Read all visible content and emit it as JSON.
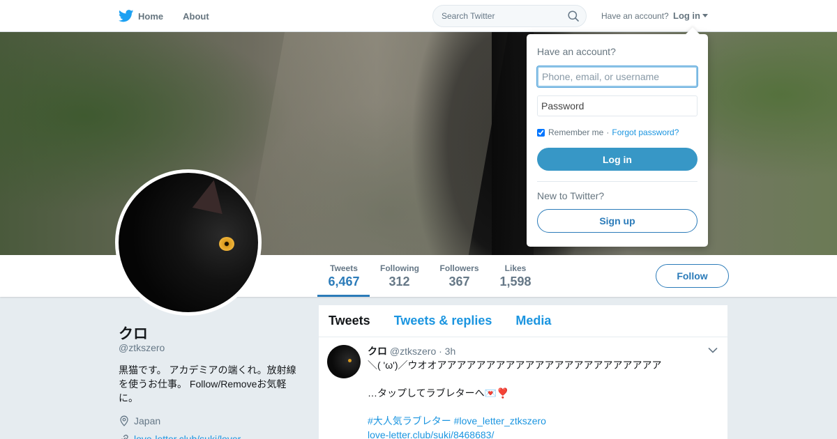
{
  "nav": {
    "logo_icon": "twitter-bird-icon",
    "home_label": "Home",
    "about_label": "About",
    "search_placeholder": "Search Twitter",
    "account_prompt": "Have an account?",
    "login_label": "Log in"
  },
  "profile": {
    "name": "クロ",
    "handle": "@ztkszero",
    "bio": "黒猫です。 アカデミアの端くれ。放射線を使うお仕事。 Follow/Removeお気軽に。",
    "location": "Japan",
    "link": "love-letter.club/suki/lover...",
    "follow_label": "Follow"
  },
  "stats": [
    {
      "label": "Tweets",
      "value": "6,467"
    },
    {
      "label": "Following",
      "value": "312"
    },
    {
      "label": "Followers",
      "value": "367"
    },
    {
      "label": "Likes",
      "value": "1,598"
    }
  ],
  "tabs": [
    "Tweets",
    "Tweets & replies",
    "Media"
  ],
  "tweet": {
    "name": "クロ",
    "handle": "@ztkszero",
    "time": "· 3h",
    "line1": "＼( 'ω')／ウオオアアアアアアアアアアアアアアアアアアアアアアア",
    "line2": "…タップしてラブレターへ💌❣️",
    "hashtags": "#大人気ラブレター #love_letter_ztkszero",
    "url": "love-letter.club/suki/8468683/"
  },
  "login_dropdown": {
    "title": "Have an account?",
    "username_placeholder": "Phone, email, or username",
    "password_placeholder": "Password",
    "remember_label": "Remember me",
    "separator": "·",
    "forgot_label": "Forgot password?",
    "login_button": "Log in",
    "new_prompt": "New to Twitter?",
    "signup_button": "Sign up"
  },
  "colors": {
    "accent": "#1b95e0",
    "link": "#2b7bb9",
    "login_button": "#3797c6",
    "page_bg": "#e6ecf0"
  }
}
